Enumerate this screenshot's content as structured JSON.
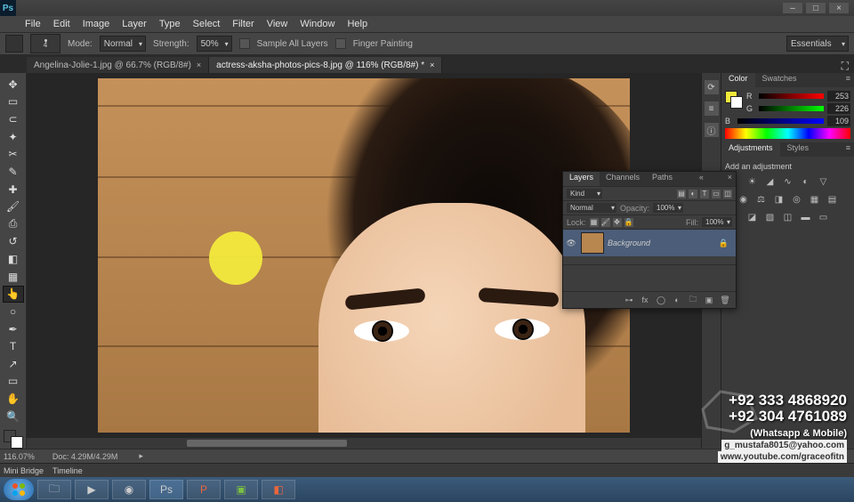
{
  "app": {
    "logo": "Ps"
  },
  "menubar": [
    "File",
    "Edit",
    "Image",
    "Layer",
    "Type",
    "Select",
    "Filter",
    "View",
    "Window",
    "Help"
  ],
  "opt": {
    "brush_size": "4",
    "mode_label": "Mode:",
    "mode_value": "Normal",
    "strength_label": "Strength:",
    "strength_value": "50%",
    "sample_all": "Sample All Layers",
    "finger_paint": "Finger Painting",
    "workspace": "Essentials"
  },
  "tabs": [
    {
      "title": "Angelina-Jolie-1.jpg @ 66.7% (RGB/8#)"
    },
    {
      "title": "actress-aksha-photos-pics-8.jpg @ 116% (RGB/8#) *",
      "active": true
    }
  ],
  "color_panel": {
    "tabs": [
      "Color",
      "Swatches"
    ],
    "r_label": "R",
    "r": "253",
    "g_label": "G",
    "g": "226",
    "b_label": "B",
    "b": "109",
    "fg": "#f2e93c"
  },
  "adj_panel": {
    "tabs": [
      "Adjustments",
      "Styles"
    ],
    "title": "Add an adjustment"
  },
  "layers_panel": {
    "tabs": [
      "Layers",
      "Channels",
      "Paths"
    ],
    "kind": "Kind",
    "blend": "Normal",
    "opacity_label": "Opacity:",
    "opacity": "100%",
    "lock_label": "Lock:",
    "fill_label": "Fill:",
    "fill": "100%",
    "layer_name": "Background"
  },
  "status": {
    "zoom": "116.07%",
    "doc": "Doc: 4.29M/4.29M"
  },
  "bottom_tabs": [
    "Mini Bridge",
    "Timeline"
  ],
  "overlay": {
    "phone1": "+92 333 4868920",
    "phone2": "+92 304 4761089",
    "tag": "(Whatsapp & Mobile)",
    "email": "g_mustafa8015@yahoo.com",
    "yt": "www.youtube.com/graceofitn"
  },
  "cursor_color": "#f2e93c"
}
